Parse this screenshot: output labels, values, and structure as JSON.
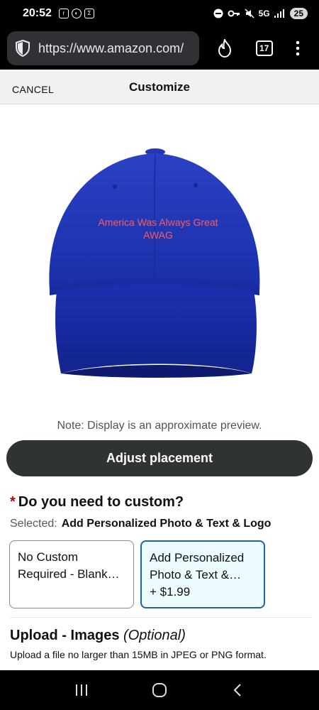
{
  "status_bar": {
    "time": "20:52",
    "left_icons": [
      "ring-icon",
      "vpn-icon",
      "sigma-icon"
    ],
    "network": "5G",
    "battery": "25"
  },
  "browser": {
    "url": "https://www.amazon.com/",
    "tab_count": "17"
  },
  "header": {
    "cancel_label": "CANCEL",
    "title": "Customize"
  },
  "preview": {
    "cap_color": "#1e35b5",
    "text_color": "#ff5a5a",
    "cap_text_line1": "America Was Always Great",
    "cap_text_line2": "AWAG",
    "note": "Note: Display is an approximate preview."
  },
  "adjust_button": "Adjust placement",
  "customization": {
    "required_marker": "*",
    "question": "Do you need to custom?",
    "selected_label": "Selected:",
    "selected_value": "Add Personalized Photo & Text & Logo",
    "options": [
      {
        "line1": "No Custom",
        "line2": "Required - Blank…",
        "price": "",
        "selected": false
      },
      {
        "line1": "Add Personalized",
        "line2": "Photo & Text &…",
        "price": "+ $1.99",
        "selected": true
      }
    ]
  },
  "upload": {
    "title": "Upload - Images",
    "optional": "(Optional)",
    "description": "Upload a file no larger than 15MB in JPEG or PNG format."
  },
  "colors": {
    "accent_blue": "#2162a1",
    "button_dark": "#303333",
    "required_red": "#c40000"
  }
}
